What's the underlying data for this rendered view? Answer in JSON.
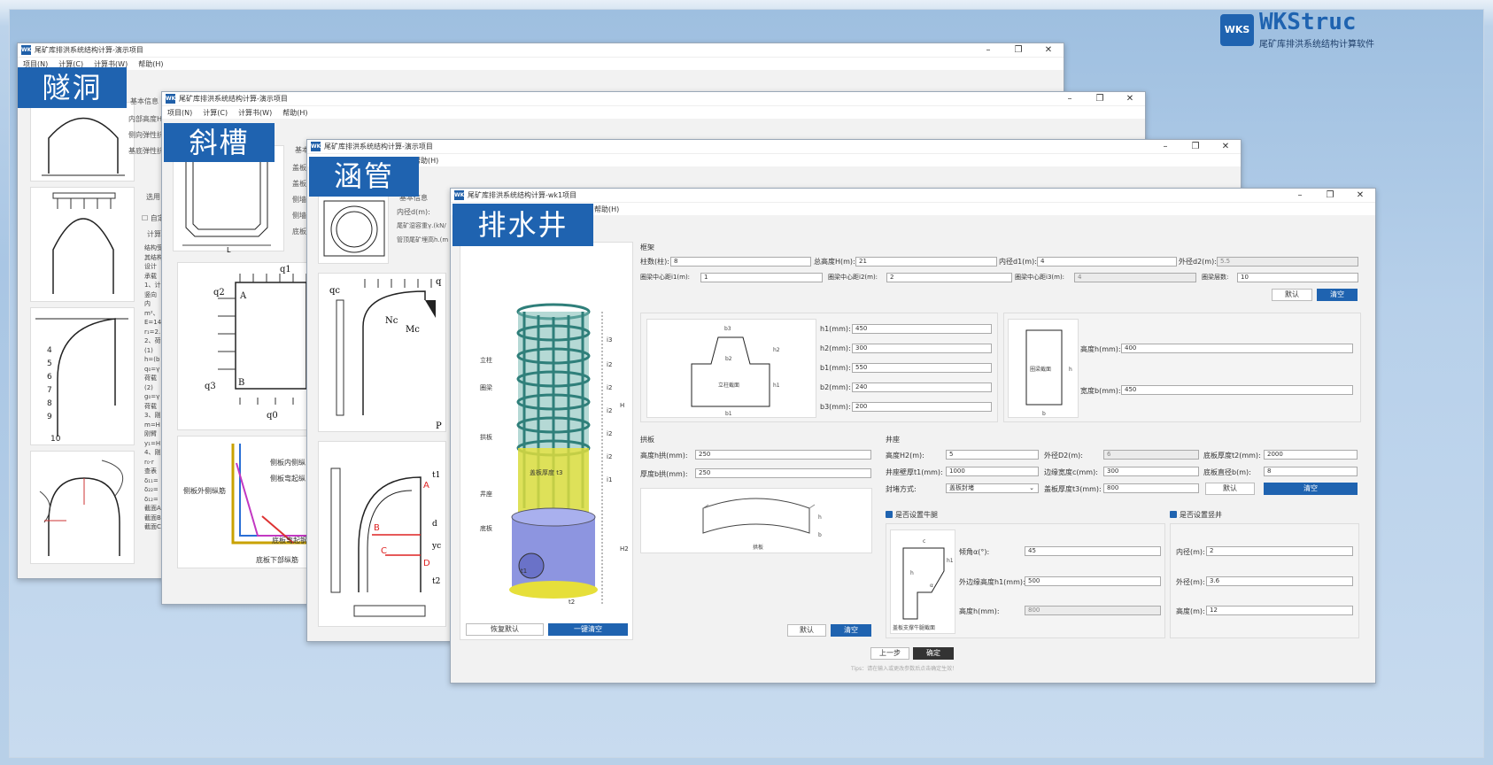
{
  "brand": {
    "logo": "WKS",
    "name": "WKStruc",
    "subtitle": "尾矿库排洪系统结构计算软件"
  },
  "windows": {
    "tunnel": {
      "title": "尾矿库排洪系统结构计算-演示项目",
      "menu": [
        "项目(N)",
        "计算(C)",
        "计算书(W)",
        "帮助(H)"
      ],
      "tag": "隧洞",
      "side_labels": [
        "基本信息",
        "内部高度H",
        "侧向弹性抗",
        "基底弹性抗"
      ],
      "select_label": "选用",
      "check_label": "自定",
      "calc_label": "计算",
      "text_lines": [
        "结构受",
        "其结构",
        "设计",
        "承载",
        "1、计",
        "竖向",
        "内",
        "m²、",
        "E=14",
        "r₁=2.",
        "2、荷",
        "(1)",
        "h=(b",
        "q₀=γ",
        "荷载",
        "(2)",
        "g₀=γ",
        "荷载",
        "3、刚",
        "m=H",
        "刚臂",
        "y₁=H",
        "4、刚",
        "r₀·r",
        "查表",
        "δ₁₁=",
        "δ₂₂=",
        "δ₁₂=",
        "截面A",
        "截面B",
        "截面C"
      ]
    },
    "chute": {
      "title": "尾矿库排洪系统结构计算-演示项目",
      "menu": [
        "项目(N)",
        "计算(C)",
        "计算书(W)",
        "帮助(H)"
      ],
      "tag": "斜槽",
      "side_labels": [
        "基本",
        "盖板",
        "盖板",
        "侧墙",
        "侧墙",
        "底板"
      ],
      "fig_labels": {
        "q1": "q1",
        "q2": "q2",
        "q3": "q3",
        "q0": "q0",
        "A": "A",
        "B": "B"
      },
      "rebar_labels": [
        "侧板内侧纵",
        "侧板弯起纵",
        "侧板外侧纵筋",
        "底板弯起钢",
        "底板下部纵筋"
      ]
    },
    "culvert": {
      "title": "尾矿库排洪系统结构计算-演示项目",
      "menu_tail": "帮助(H)",
      "tag": "涵管",
      "fields": [
        "内径d(m):",
        "尾矿湿容重γ.(kN/",
        "管顶尾矿埋高h.(m"
      ],
      "base_label": "基本信息",
      "fig_labels": {
        "qc": "qc",
        "q": "q",
        "Nc": "Nc",
        "Mc": "Mc",
        "p": "P",
        "A": "A",
        "B": "B",
        "C": "C",
        "D": "D",
        "t1": "t1",
        "yc": "yc",
        "d": "d",
        "t2": "t2"
      }
    },
    "well": {
      "title": "尾矿库排洪系统结构计算-wk1项目",
      "menu_tail": "帮助(H)",
      "tag": "排水井",
      "model_labels": {
        "column": "立柱",
        "ring_beam": "圈梁",
        "arch": "拱板",
        "seat": "井座",
        "base": "底板",
        "thickness": "盖板厚度 t3",
        "dims": [
          "i3",
          "i2",
          "i2",
          "i2",
          "i2",
          "i2",
          "i1",
          "H",
          "H2",
          "t1",
          "t2"
        ]
      },
      "left_buttons": {
        "reset": "恢复默认",
        "clear_all": "一键清空"
      },
      "frame": {
        "title": "框架",
        "row1": [
          {
            "label": "柱数(柱):",
            "value": "8"
          },
          {
            "label": "总高度H(m):",
            "value": "21"
          },
          {
            "label": "内径d1(m):",
            "value": "4"
          },
          {
            "label": "外径d2(m):",
            "value": "5.5"
          }
        ],
        "row2": [
          {
            "label": "圈梁中心距i1(m):",
            "value": "1"
          },
          {
            "label": "圈梁中心距i2(m):",
            "value": "2"
          },
          {
            "label": "圈梁中心距i3(m):",
            "value": "4"
          },
          {
            "label": "圈梁层数:",
            "value": "10"
          }
        ],
        "default": "默认",
        "clear": "清空"
      },
      "column": {
        "section_label": "立柱截面",
        "dims": [
          "b3",
          "b2",
          "b1",
          "h2",
          "h1"
        ],
        "fields": [
          {
            "label": "h1(mm):",
            "value": "450"
          },
          {
            "label": "h2(mm):",
            "value": "300"
          },
          {
            "label": "b1(mm):",
            "value": "550"
          },
          {
            "label": "b2(mm):",
            "value": "240"
          },
          {
            "label": "b3(mm):",
            "value": "200"
          }
        ]
      },
      "beam": {
        "section_label": "圈梁截面",
        "dims": [
          "h",
          "b"
        ],
        "fields": [
          {
            "label": "高度h(mm):",
            "value": "400"
          },
          {
            "label": "宽度b(mm):",
            "value": "450"
          }
        ]
      },
      "arch": {
        "title": "拱板",
        "fields": [
          {
            "label": "高度h拱(mm):",
            "value": "250"
          },
          {
            "label": "厚度b拱(mm):",
            "value": "250"
          }
        ],
        "fig_label": "拱板",
        "dims": [
          "h",
          "b"
        ]
      },
      "seat": {
        "title": "井座",
        "row1": [
          {
            "label": "高度H2(m):",
            "value": "5"
          },
          {
            "label": "外径D2(m):",
            "value": "6"
          },
          {
            "label": "底板厚度t2(mm):",
            "value": "2000"
          }
        ],
        "row2": [
          {
            "label": "井座壁厚t1(mm):",
            "value": "1000"
          },
          {
            "label": "边缘宽度c(mm):",
            "value": "300"
          },
          {
            "label": "底板直径b(m):",
            "value": "8"
          }
        ],
        "seal_label": "封堵方式:",
        "seal_value": "盖板封堵",
        "cover_label": "盖板厚度t3(mm):",
        "cover_value": "800",
        "default": "默认",
        "clear": "清空"
      },
      "corbel": {
        "check": "是否设置牛腿",
        "fig_label": "盖板支撑牛腿截面",
        "dims": [
          "c",
          "h1",
          "h",
          "α"
        ],
        "fields": [
          {
            "label": "倾角α(°):",
            "value": "45"
          },
          {
            "label": "外边缘高度h1(mm):",
            "value": "500"
          },
          {
            "label": "高度h(mm):",
            "value": "800"
          }
        ]
      },
      "shaft": {
        "check": "是否设置竖井",
        "fields": [
          {
            "label": "内径(m):",
            "value": "2"
          },
          {
            "label": "外径(m):",
            "value": "3.6"
          },
          {
            "label": "高度(m):",
            "value": "12"
          }
        ]
      },
      "bottom": {
        "default": "默认",
        "clear": "清空",
        "prev": "上一步",
        "ok": "确定",
        "tips": "Tips：请在输入或更改参数后点击确定生效！"
      }
    }
  }
}
